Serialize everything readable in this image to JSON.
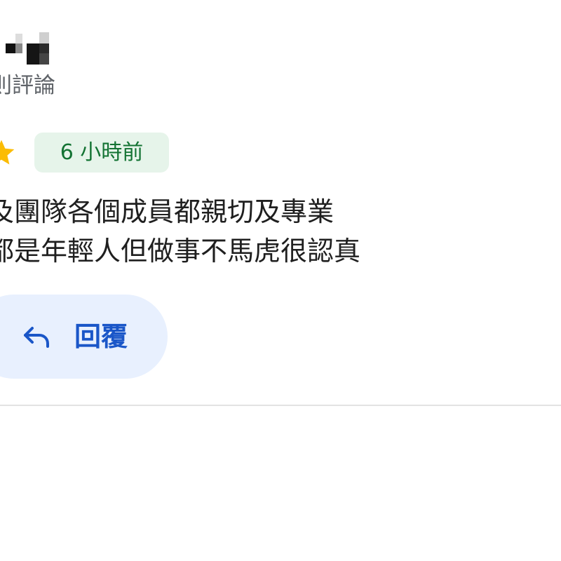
{
  "reviewer": {
    "meta_text": "則評論"
  },
  "review": {
    "time_ago": "6 小時前",
    "text_lines": [
      "及團隊各個成員都親切及專業",
      "都是年輕人但做事不馬虎很認真"
    ]
  },
  "actions": {
    "reply_label": "回覆",
    "reply_icon": "reply-arrow-icon"
  },
  "colors": {
    "star": "#fbbc04",
    "badge_bg": "#e6f4ea",
    "badge_text": "#137333",
    "reply_bg": "#e8f0fe",
    "reply_text": "#1a56c8"
  }
}
